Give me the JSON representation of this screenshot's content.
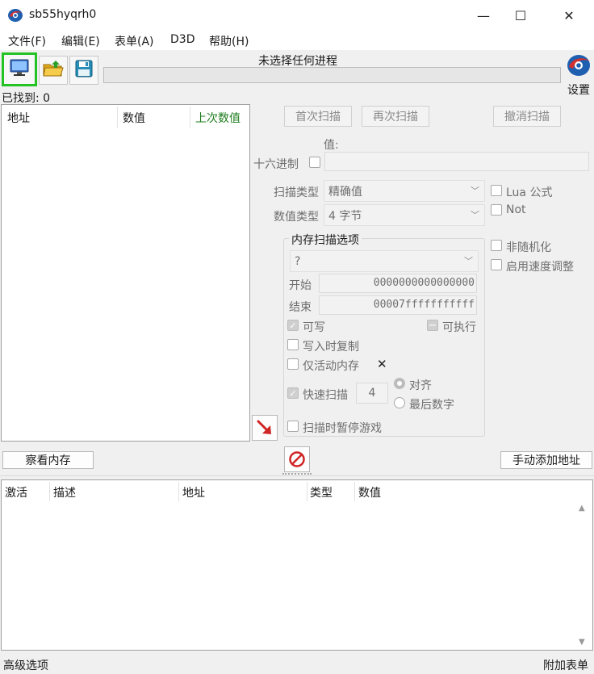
{
  "window": {
    "title": "sb55hyqrh0",
    "minimize": "—",
    "maximize": "☐",
    "close": "✕"
  },
  "menu": [
    "文件(F)",
    "编辑(E)",
    "表单(A)",
    "D3D",
    "帮助(H)"
  ],
  "toolbar": {
    "process_label": "未选择任何进程",
    "settings_label": "设置",
    "open_process_icon": "computer-icon",
    "open_file_icon": "folder-open-icon",
    "save_icon": "floppy-disk-icon"
  },
  "found": "已找到: 0",
  "results": {
    "columns": [
      "地址",
      "数值",
      "上次数值"
    ]
  },
  "scan": {
    "first_scan": "首次扫描",
    "next_scan": "再次扫描",
    "undo_scan": "撤消扫描",
    "value_label": "值:",
    "hex_label": "十六进制",
    "scan_type_label": "扫描类型",
    "scan_type_value": "精确值",
    "value_type_label": "数值类型",
    "value_type_value": "4 字节",
    "lua_formula": "Lua 公式",
    "not_label": "Not",
    "mem_options_title": "内存扫描选项",
    "mem_region": "?",
    "start_label": "开始",
    "start_value": "0000000000000000",
    "end_label": "结束",
    "end_value": "00007fffffffffff",
    "writable": "可写",
    "executable": "可执行",
    "copy_on_write": "写入时复制",
    "active_memory_only": "仅活动内存",
    "fast_scan": "快速扫描",
    "fast_scan_value": "4",
    "align": "对齐",
    "last_digits": "最后数字",
    "pause_game": "扫描时暂停游戏",
    "no_randomize": "非随机化",
    "speedhack": "启用速度调整"
  },
  "buttons": {
    "view_memory": "察看内存",
    "add_address": "手动添加地址"
  },
  "table": {
    "columns": [
      "激活",
      "描述",
      "地址",
      "类型",
      "数值"
    ]
  },
  "status": {
    "advanced": "高级选项",
    "attach_table": "附加表单"
  },
  "colors": {
    "highlight_green": "#22c322",
    "last_value_green": "#1e7d1e",
    "arrow_red": "#d02525"
  }
}
